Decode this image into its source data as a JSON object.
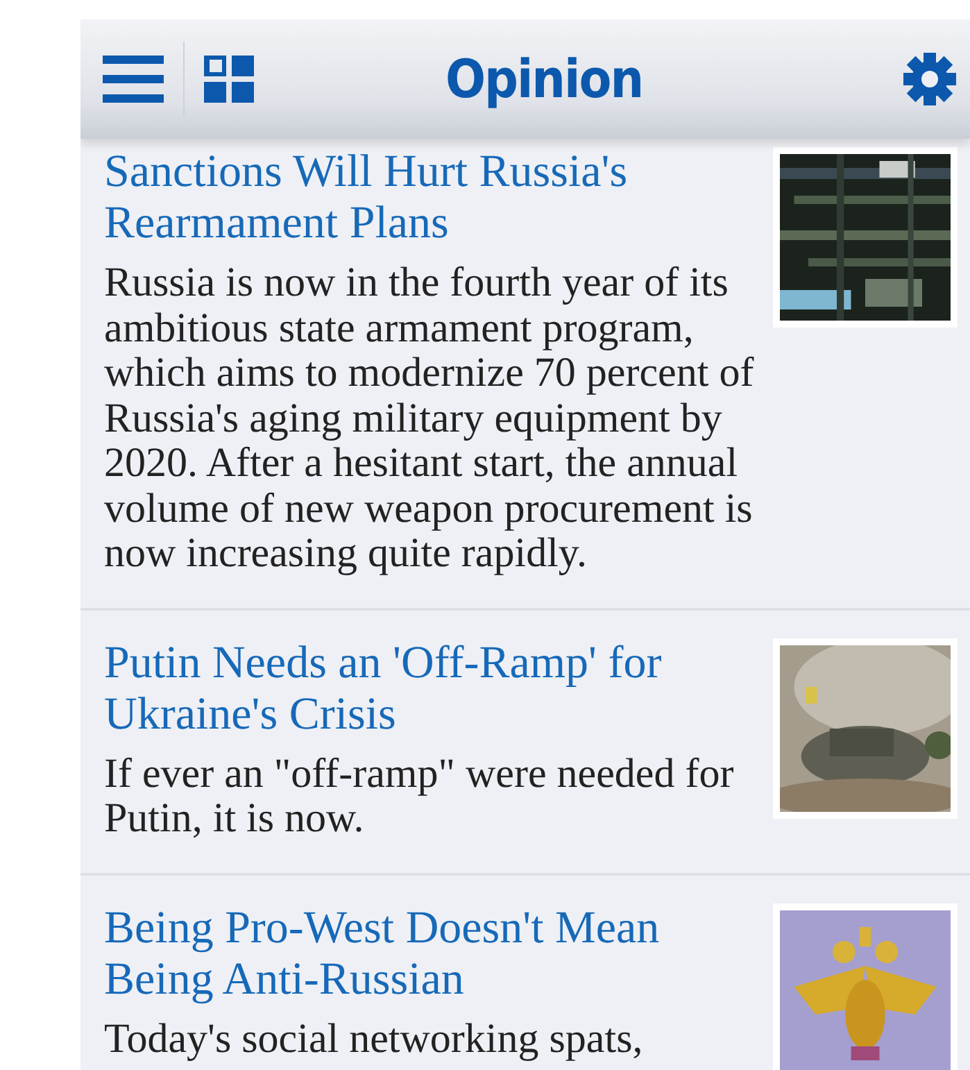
{
  "header": {
    "title": "Opinion"
  },
  "articles": [
    {
      "title": "Sanctions Will Hurt Russia's Rearmament Plans",
      "summary": "Russia is now in the fourth year of its ambitious state armament program, which aims to modernize 70 percent of Russia's aging military equipment by 2020. After a hesitant start, the annual volume of new weapon procurement is now increasing quite rapidly."
    },
    {
      "title": "Putin Needs an 'Off-Ramp' for Ukraine's Crisis",
      "summary": "If ever an \"off-ramp\" were needed for Putin, it is now."
    },
    {
      "title": "Being Pro-West Doesn't Mean Being Anti-Russian",
      "summary": "Today's social networking spats,"
    }
  ]
}
